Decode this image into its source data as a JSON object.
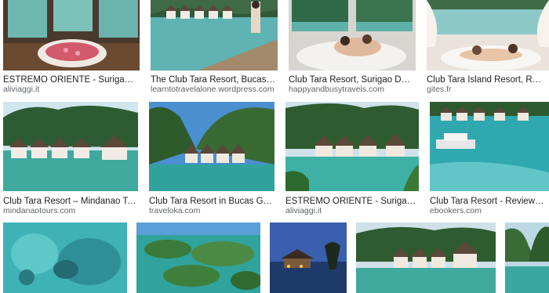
{
  "results": [
    {
      "caption": "ESTREMO ORIENTE - Surigao - hotel CLUB TARA...",
      "source": "aliviaggi.it"
    },
    {
      "caption": "The Club Tara Resort, Bucas Grande, Socorro...",
      "source": "learntotravelalone.wordpress.com"
    },
    {
      "caption": "Club Tara Resort, Surigao Del Norte - Happy ...",
      "source": "happyandbusytravels.com"
    },
    {
      "caption": "Club Tara Island Resort, Residenza di vaca...",
      "source": "gites.fr"
    },
    {
      "caption": "Club Tara Resort – Mindanao Tours",
      "source": "mindanaotours.com"
    },
    {
      "caption": "Club Tara Resort in Bucas Grande Island, S...",
      "source": "traveloka.com"
    },
    {
      "caption": "ESTREMO ORIENTE - Surigao - hotel CLUB TAR...",
      "source": "aliviaggi.it"
    },
    {
      "caption": "Club Tara Resort - Reviews, Photos & R...",
      "source": "ebookers.com"
    },
    {
      "caption": "",
      "source": ""
    },
    {
      "caption": "",
      "source": ""
    },
    {
      "caption": "",
      "source": ""
    },
    {
      "caption": "",
      "source": ""
    },
    {
      "caption": "",
      "source": ""
    }
  ]
}
